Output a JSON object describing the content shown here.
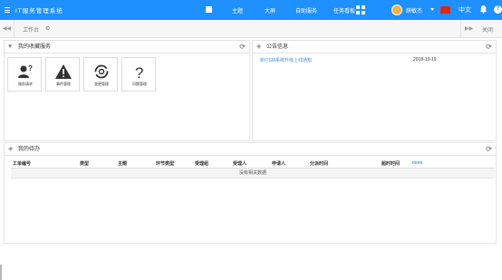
{
  "header": {
    "app_title": "IT服务管理系统",
    "nav": [
      "主题",
      "大屏",
      "自助服务",
      "任务看板"
    ],
    "user_name": "薛敏杰",
    "language": "中文",
    "help_symbol": "?",
    "brand_color": "#1e90ff"
  },
  "tabs": {
    "active_tab": "工作台",
    "gear_symbol": "⚙",
    "left_arrow": "◀◀",
    "right_arrow": "▶▶",
    "close_label": "关闭"
  },
  "favorites": {
    "title": "我的收藏服务",
    "items": [
      "服务请求",
      "事件管理",
      "变更管理",
      "问题管理"
    ]
  },
  "notices": {
    "title": "公告信息",
    "items": [
      {
        "text": "新ITSM系统升级上线通知",
        "date": "2018-10-19"
      }
    ]
  },
  "todo": {
    "title": "我的待办",
    "columns": [
      "工单编号",
      "类型",
      "主题",
      "环节类型",
      "受理组",
      "受理人",
      "申请人",
      "分派时间",
      "超时时间"
    ],
    "more_label": "more",
    "empty_text": "没有相关数据"
  }
}
